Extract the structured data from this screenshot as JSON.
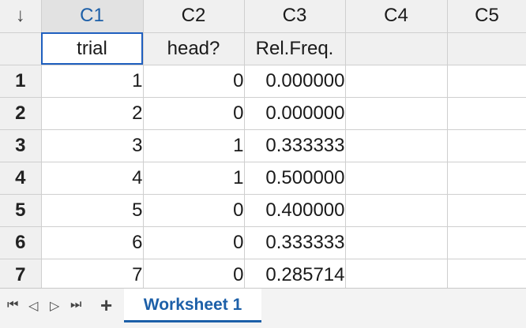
{
  "columns": [
    {
      "id": "C1",
      "name": "trial"
    },
    {
      "id": "C2",
      "name": "head?"
    },
    {
      "id": "C3",
      "name": "Rel.Freq."
    },
    {
      "id": "C4",
      "name": ""
    },
    {
      "id": "C5",
      "name": ""
    }
  ],
  "corner_glyph": "↓",
  "rows": [
    {
      "num": "1",
      "c1": "1",
      "c2": "0",
      "c3": "0.000000"
    },
    {
      "num": "2",
      "c1": "2",
      "c2": "0",
      "c3": "0.000000"
    },
    {
      "num": "3",
      "c1": "3",
      "c2": "1",
      "c3": "0.333333"
    },
    {
      "num": "4",
      "c1": "4",
      "c2": "1",
      "c3": "0.500000"
    },
    {
      "num": "5",
      "c1": "5",
      "c2": "0",
      "c3": "0.400000"
    },
    {
      "num": "6",
      "c1": "6",
      "c2": "0",
      "c3": "0.333333"
    },
    {
      "num": "7",
      "c1": "7",
      "c2": "0",
      "c3": "0.285714"
    }
  ],
  "tabbar": {
    "first_icon": "⏮",
    "prev_icon": "◁",
    "next_icon": "▷",
    "last_icon": "⏭",
    "add_icon": "+",
    "active_tab": "Worksheet 1"
  },
  "colors": {
    "accent": "#1c5fa8",
    "header_bg": "#f0f0f0",
    "gridline": "#cfcfcf"
  }
}
